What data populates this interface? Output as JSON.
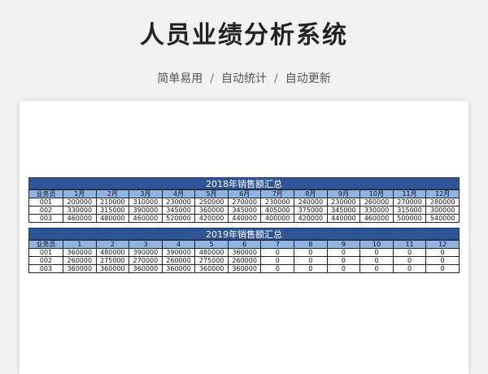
{
  "header": {
    "title": "人员业绩分析系统",
    "subtitle_parts": [
      "简单易用",
      "自动统计",
      "自动更新"
    ],
    "separator": "/"
  },
  "tables": [
    {
      "title": "2018年销售额汇总",
      "columns": [
        "业务员",
        "1月",
        "2月",
        "3月",
        "4月",
        "5月",
        "6月",
        "7月",
        "8月",
        "9月",
        "10月",
        "11月",
        "12月"
      ],
      "rows": [
        [
          "001",
          "200000",
          "210000",
          "310000",
          "230000",
          "250000",
          "270000",
          "230000",
          "240000",
          "230000",
          "260000",
          "270000",
          "280000"
        ],
        [
          "002",
          "330000",
          "315000",
          "390000",
          "345000",
          "360000",
          "345000",
          "405000",
          "375000",
          "345000",
          "330000",
          "315000",
          "300000"
        ],
        [
          "003",
          "460000",
          "480000",
          "460000",
          "520000",
          "420000",
          "440000",
          "400000",
          "420000",
          "440000",
          "460000",
          "500000",
          "540000"
        ]
      ]
    },
    {
      "title": "2019年销售额汇总",
      "columns": [
        "业务员",
        "1",
        "2",
        "3",
        "4",
        "5",
        "6",
        "7",
        "8",
        "9",
        "10",
        "11",
        "12"
      ],
      "rows": [
        [
          "001",
          "360000",
          "480000",
          "390000",
          "390000",
          "480000",
          "360000",
          "0",
          "0",
          "0",
          "0",
          "0",
          "0"
        ],
        [
          "002",
          "260000",
          "275000",
          "270000",
          "260000",
          "275000",
          "260000",
          "0",
          "0",
          "0",
          "0",
          "0",
          "0"
        ],
        [
          "003",
          "360000",
          "360000",
          "360000",
          "360000",
          "360000",
          "360000",
          "0",
          "0",
          "0",
          "0",
          "0",
          "0"
        ]
      ]
    }
  ],
  "colors": {
    "title_bar": "#2f5597",
    "header_row": "#8eb4e3"
  }
}
